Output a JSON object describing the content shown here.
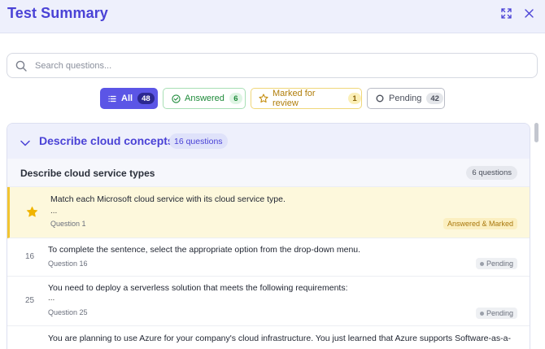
{
  "header": {
    "title": "Test Summary"
  },
  "search": {
    "placeholder": "Search questions..."
  },
  "filters": [
    {
      "label": "All",
      "count": "48"
    },
    {
      "label": "Answered",
      "count": "6"
    },
    {
      "label": "Marked for review",
      "count": "1"
    },
    {
      "label": "Pending",
      "count": "42"
    }
  ],
  "section": {
    "title": "Describe cloud concepts",
    "badge": "16 questions",
    "subsection": {
      "title": "Describe cloud service types",
      "badge": "6 questions"
    },
    "questions": [
      {
        "num": "",
        "text": "Match each Microsoft cloud service with its cloud service type.",
        "extra": "...",
        "sub": "Question 1",
        "status": "Answered & Marked"
      },
      {
        "num": "16",
        "text": "To complete the sentence, select the appropriate option from the drop-down menu.",
        "extra": "",
        "sub": "Question 16",
        "status": "Pending"
      },
      {
        "num": "25",
        "text": "You need to deploy a serverless solution that meets the following requirements:",
        "extra": "...",
        "sub": "Question 25",
        "status": "Pending"
      },
      {
        "num": "",
        "text": "You are planning to use Azure for your company's cloud infrastructure. You just learned that Azure supports Software-as-a-",
        "extra": "",
        "sub": "",
        "status": ""
      }
    ]
  },
  "colors": {
    "accent": "#4a42d6",
    "marked": "#f2c531",
    "answered": "#1e8a3a"
  }
}
